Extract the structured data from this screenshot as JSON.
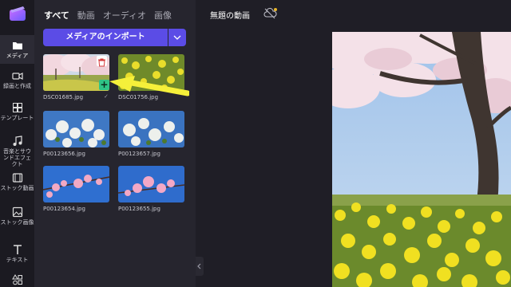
{
  "rail": {
    "items": [
      {
        "label": "メディア",
        "icon": "folder-icon"
      },
      {
        "label": "録画と作成",
        "icon": "video-camera-icon"
      },
      {
        "label": "テンプレート",
        "icon": "templates-icon"
      },
      {
        "label": "音楽とサウンドエフェクト",
        "icon": "music-note-icon"
      },
      {
        "label": "ストック動画",
        "icon": "film-icon"
      },
      {
        "label": "ストック画像",
        "icon": "image-icon"
      },
      {
        "label": "テキスト",
        "icon": "text-icon"
      },
      {
        "label": "",
        "icon": "shapes-icon"
      }
    ]
  },
  "panel": {
    "tabs": [
      "すべて",
      "動画",
      "オーディオ",
      "画像"
    ],
    "import_label": "メディアのインポート",
    "files": [
      "DSC01685.jpg",
      "DSC01756.jpg",
      "P00123656.jpg",
      "P00123657.jpg",
      "P00123654.jpg",
      "P00123655.jpg"
    ],
    "add_label": "+",
    "check_label": "✓"
  },
  "main": {
    "project_title": "無題の動画"
  },
  "colors": {
    "accent": "#5b4ce6",
    "add_green": "#2fc486",
    "arrow_yellow": "#f5f03a"
  }
}
